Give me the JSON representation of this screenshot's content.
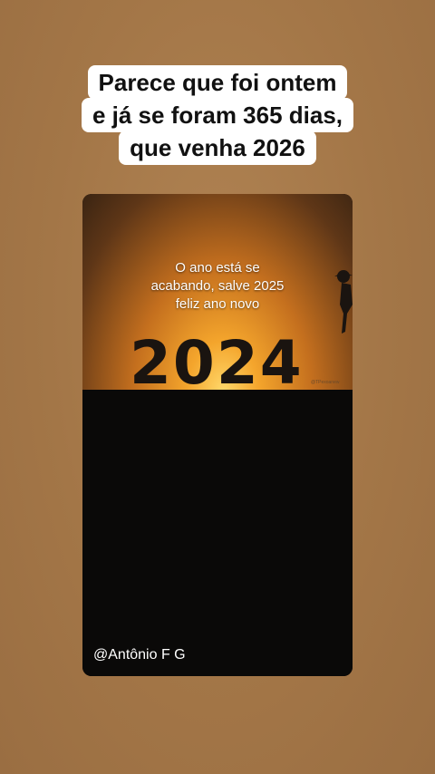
{
  "caption": {
    "line1": "Parece que foi ontem",
    "line2": "e já se foram 365 dias,",
    "line3": "que venha 2026"
  },
  "video": {
    "overlay_line1": "O ano está se",
    "overlay_line2": "acabando, salve 2025",
    "overlay_line3": "feliz ano novo",
    "year": "2024",
    "watermark": "@TPexoanew",
    "handle": "@Antônio F G"
  },
  "colors": {
    "background": "#a67a4a",
    "caption_bg": "#ffffff",
    "ground": "#0a0908",
    "sun": "#ffd86a"
  }
}
